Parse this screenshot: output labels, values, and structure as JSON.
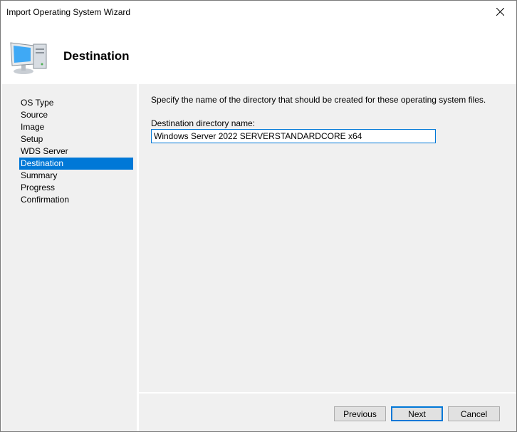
{
  "window": {
    "title": "Import Operating System Wizard"
  },
  "header": {
    "title": "Destination",
    "icon": "computer-icon"
  },
  "sidebar": {
    "items": [
      {
        "label": "OS Type"
      },
      {
        "label": "Source"
      },
      {
        "label": "Image"
      },
      {
        "label": "Setup"
      },
      {
        "label": "WDS Server"
      },
      {
        "label": "Destination",
        "selected": true
      },
      {
        "label": "Summary"
      },
      {
        "label": "Progress"
      },
      {
        "label": "Confirmation"
      }
    ]
  },
  "main": {
    "description": "Specify the name of the directory that should be created for these operating system files.",
    "field_label": "Destination directory name:",
    "field_value": "Windows Server 2022 SERVERSTANDARDCORE x64"
  },
  "footer": {
    "previous": "Previous",
    "next": "Next",
    "cancel": "Cancel"
  },
  "colors": {
    "accent": "#0078d7",
    "panel": "#f0f0f0"
  }
}
